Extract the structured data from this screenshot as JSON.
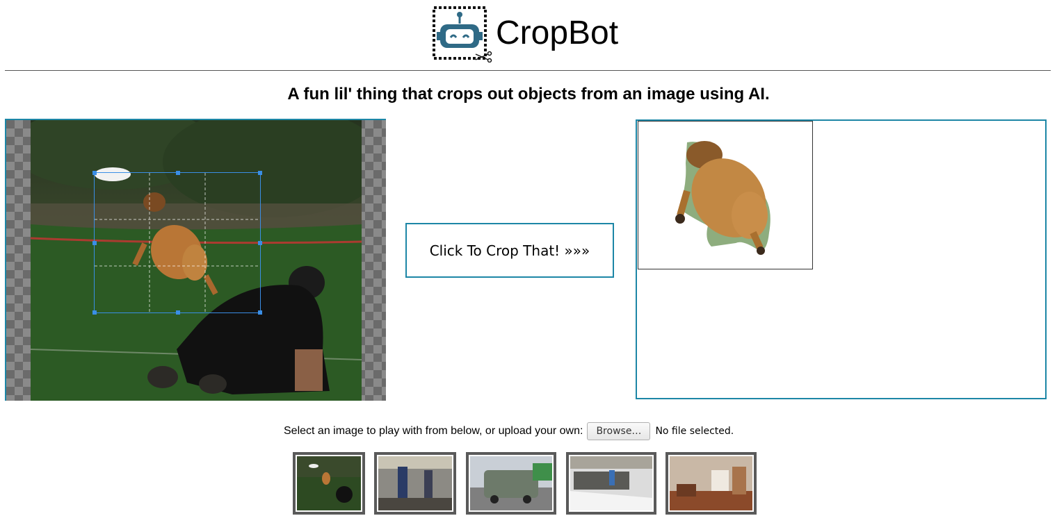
{
  "header": {
    "app_title": "CropBot",
    "logo_icon": "robot-scissors-icon"
  },
  "tagline": "A fun lil' thing that crops out objects from an image using AI.",
  "crop_button_label": "Click To Crop That! »»»",
  "upload": {
    "prompt": "Select an image to play with from below, or upload your own:",
    "browse_label": "Browse…",
    "file_status": "No file selected."
  },
  "thumbnails": [
    {
      "name": "dog-frisbee"
    },
    {
      "name": "tram-passengers"
    },
    {
      "name": "van-street"
    },
    {
      "name": "snowy-parking-lot"
    },
    {
      "name": "living-room"
    }
  ],
  "colors": {
    "accent": "#1c86a6",
    "crop_selection": "#3a8ee6",
    "logo": "#2f6a86"
  }
}
